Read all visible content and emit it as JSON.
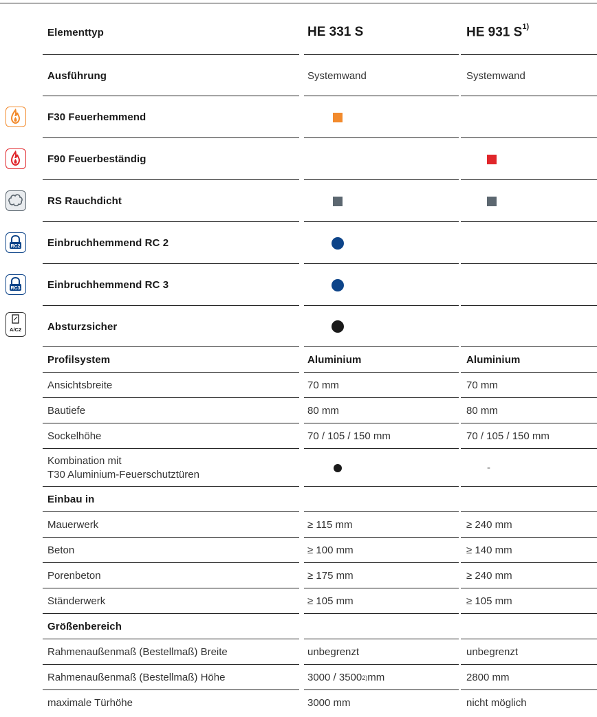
{
  "colors": {
    "fire30": "#f28a2c",
    "fire90": "#e0262b",
    "smoke": "#5c6770",
    "rc": "#0d4489",
    "black": "#1a1a1a"
  },
  "header": {
    "label": "Elementtyp",
    "col1": "HE 331 S",
    "col2": "HE 931 S",
    "col2_footnote": "1)"
  },
  "ausfuehrung": {
    "label": "Ausführung",
    "v1": "Systemwand",
    "v2": "Systemwand"
  },
  "features": [
    {
      "label": "F30 Feuerhemmend",
      "icon": "fire-f30-icon",
      "v1": "square-orange",
      "v2": ""
    },
    {
      "label": "F90 Feuerbeständig",
      "icon": "fire-f90-icon",
      "v1": "",
      "v2": "square-red"
    },
    {
      "label": "RS Rauchdicht",
      "icon": "smoke-icon",
      "v1": "square-grey",
      "v2": "square-grey"
    },
    {
      "label": "Einbruchhemmend RC 2",
      "icon": "lock-rc2-icon",
      "icon_text": "RC2",
      "v1": "dot-blue",
      "v2": ""
    },
    {
      "label": "Einbruchhemmend RC 3",
      "icon": "lock-rc3-icon",
      "icon_text": "RC3",
      "v1": "dot-blue",
      "v2": ""
    },
    {
      "label": "Absturzsicher",
      "icon": "fall-protection-icon",
      "icon_text": "A/C2",
      "v1": "dot-black",
      "v2": ""
    }
  ],
  "profil": {
    "label": "Profilsystem",
    "v1": "Aluminium",
    "v2": "Aluminium"
  },
  "profil_rows": [
    {
      "label": "Ansichtsbreite",
      "v1": "70 mm",
      "v2": "70 mm"
    },
    {
      "label": "Bautiefe",
      "v1": "80 mm",
      "v2": "80 mm"
    },
    {
      "label": "Sockelhöhe",
      "v1": "70 / 105 / 150 mm",
      "v2": "70 / 105 / 150 mm"
    }
  ],
  "kombination": {
    "label_line1": "Kombination mit",
    "label_line2": "T30 Aluminium-Feuerschutztüren",
    "v2": "-"
  },
  "einbau": {
    "label": "Einbau in"
  },
  "einbau_rows": [
    {
      "label": "Mauerwerk",
      "v1": "≥ 115 mm",
      "v2": "≥ 240 mm"
    },
    {
      "label": "Beton",
      "v1": "≥ 100 mm",
      "v2": "≥ 140 mm"
    },
    {
      "label": "Porenbeton",
      "v1": "≥ 175 mm",
      "v2": "≥ 240 mm"
    },
    {
      "label": "Ständerwerk",
      "v1": "≥ 105 mm",
      "v2": "≥ 105 mm"
    }
  ],
  "groesse": {
    "label": "Größenbereich"
  },
  "groesse_rows": [
    {
      "label": "Rahmenaußenmaß (Bestellmaß) Breite",
      "v1": "unbegrenzt",
      "v2": "unbegrenzt"
    },
    {
      "label": "Rahmenaußenmaß (Bestellmaß) Höhe",
      "v1_a": "3000 / 3500",
      "v1_fn": "2)",
      "v1_b": " mm",
      "v2": "2800 mm"
    },
    {
      "label": "maximale Türhöhe",
      "v1": "3000 mm",
      "v2": "nicht möglich"
    }
  ]
}
